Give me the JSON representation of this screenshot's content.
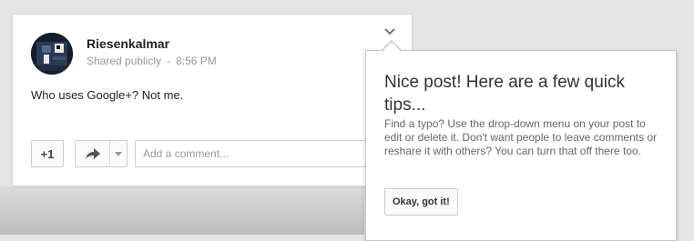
{
  "post": {
    "author": "Riesenkalmar",
    "visibility": "Shared publicly",
    "separator": "-",
    "time": "8:56 PM",
    "text": "Who uses Google+? Not me.",
    "plus_one_label": "+1",
    "comment_placeholder": "Add a comment...",
    "menu_icon": "chevron-down-icon",
    "share_icon": "share-arrow-icon"
  },
  "tip": {
    "title": "Nice post! Here are a few quick tips...",
    "body": "Find a typo? Use the drop-down menu on your post to edit or delete it. Don't want people to leave comments or reshare it with others? You can turn that off there too.",
    "ok_label": "Okay, got it!"
  },
  "colors": {
    "background": "#e5e5e5",
    "card": "#ffffff",
    "avatar_bg": "#141d2b"
  }
}
